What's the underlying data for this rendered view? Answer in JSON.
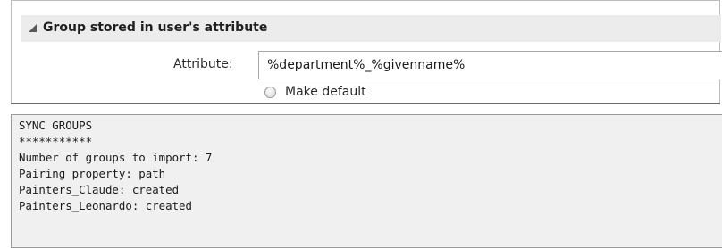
{
  "section": {
    "title": "Group stored in user's attribute",
    "collapse_icon": "triangle-down-icon"
  },
  "attribute": {
    "label": "Attribute:",
    "value": "%department%_%givenname%"
  },
  "make_default": {
    "label": "Make default",
    "checked": false
  },
  "console": {
    "lines": [
      "SYNC GROUPS",
      "***********",
      "Number of groups to import: 7",
      "Pairing property: path",
      "Painters_Claude: created",
      "Painters_Leonardo: created"
    ]
  }
}
